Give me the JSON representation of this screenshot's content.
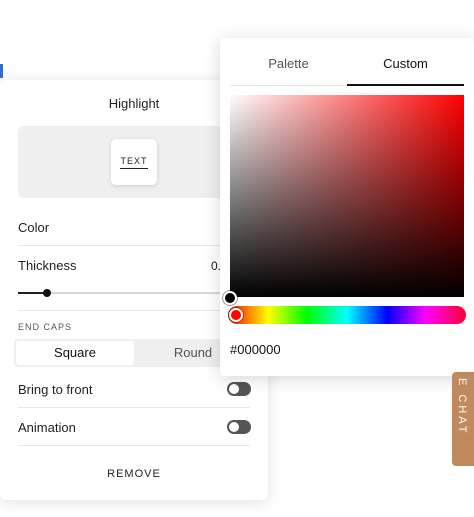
{
  "highlight_panel": {
    "title": "Highlight",
    "preview_text": "TEXT",
    "color_label": "Color",
    "thickness_label": "Thickness",
    "thickness_value": "0.",
    "thickness_slider_fraction": 0.14,
    "end_caps_label": "END CAPS",
    "end_caps_options": [
      "Square",
      "Round"
    ],
    "end_caps_selected": "Square",
    "bring_to_front_label": "Bring to front",
    "bring_to_front_on": false,
    "animation_label": "Animation",
    "animation_on": false,
    "remove_label": "REMOVE"
  },
  "color_picker": {
    "tabs": [
      "Palette",
      "Custom"
    ],
    "active_tab": "Custom",
    "hex_value": "#000000",
    "base_hue_color": "#ff0000"
  },
  "chat_tab": {
    "label": "E CHAT",
    "color": "#c08a5c"
  }
}
